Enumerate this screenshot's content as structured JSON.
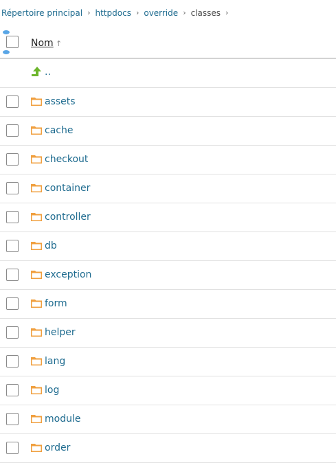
{
  "breadcrumb": {
    "items": [
      {
        "label": "Répertoire principal"
      },
      {
        "label": "httpdocs"
      },
      {
        "label": "override"
      },
      {
        "label": "classes"
      }
    ],
    "separator": "›"
  },
  "table": {
    "column_name": "Nom",
    "sort_indicator": "↑",
    "parent_label": "..",
    "rows": [
      {
        "name": "assets"
      },
      {
        "name": "cache"
      },
      {
        "name": "checkout"
      },
      {
        "name": "container"
      },
      {
        "name": "controller"
      },
      {
        "name": "db"
      },
      {
        "name": "exception"
      },
      {
        "name": "form"
      },
      {
        "name": "helper"
      },
      {
        "name": "lang"
      },
      {
        "name": "log"
      },
      {
        "name": "module"
      },
      {
        "name": "order"
      }
    ]
  },
  "colors": {
    "link": "#1e6b8f",
    "folder": "#f0a040",
    "up_arrow": "#6cb52b",
    "selection_handle": "#5aa6e6"
  },
  "icons": {
    "folder": "folder-icon",
    "parent": "up-arrow-icon"
  }
}
